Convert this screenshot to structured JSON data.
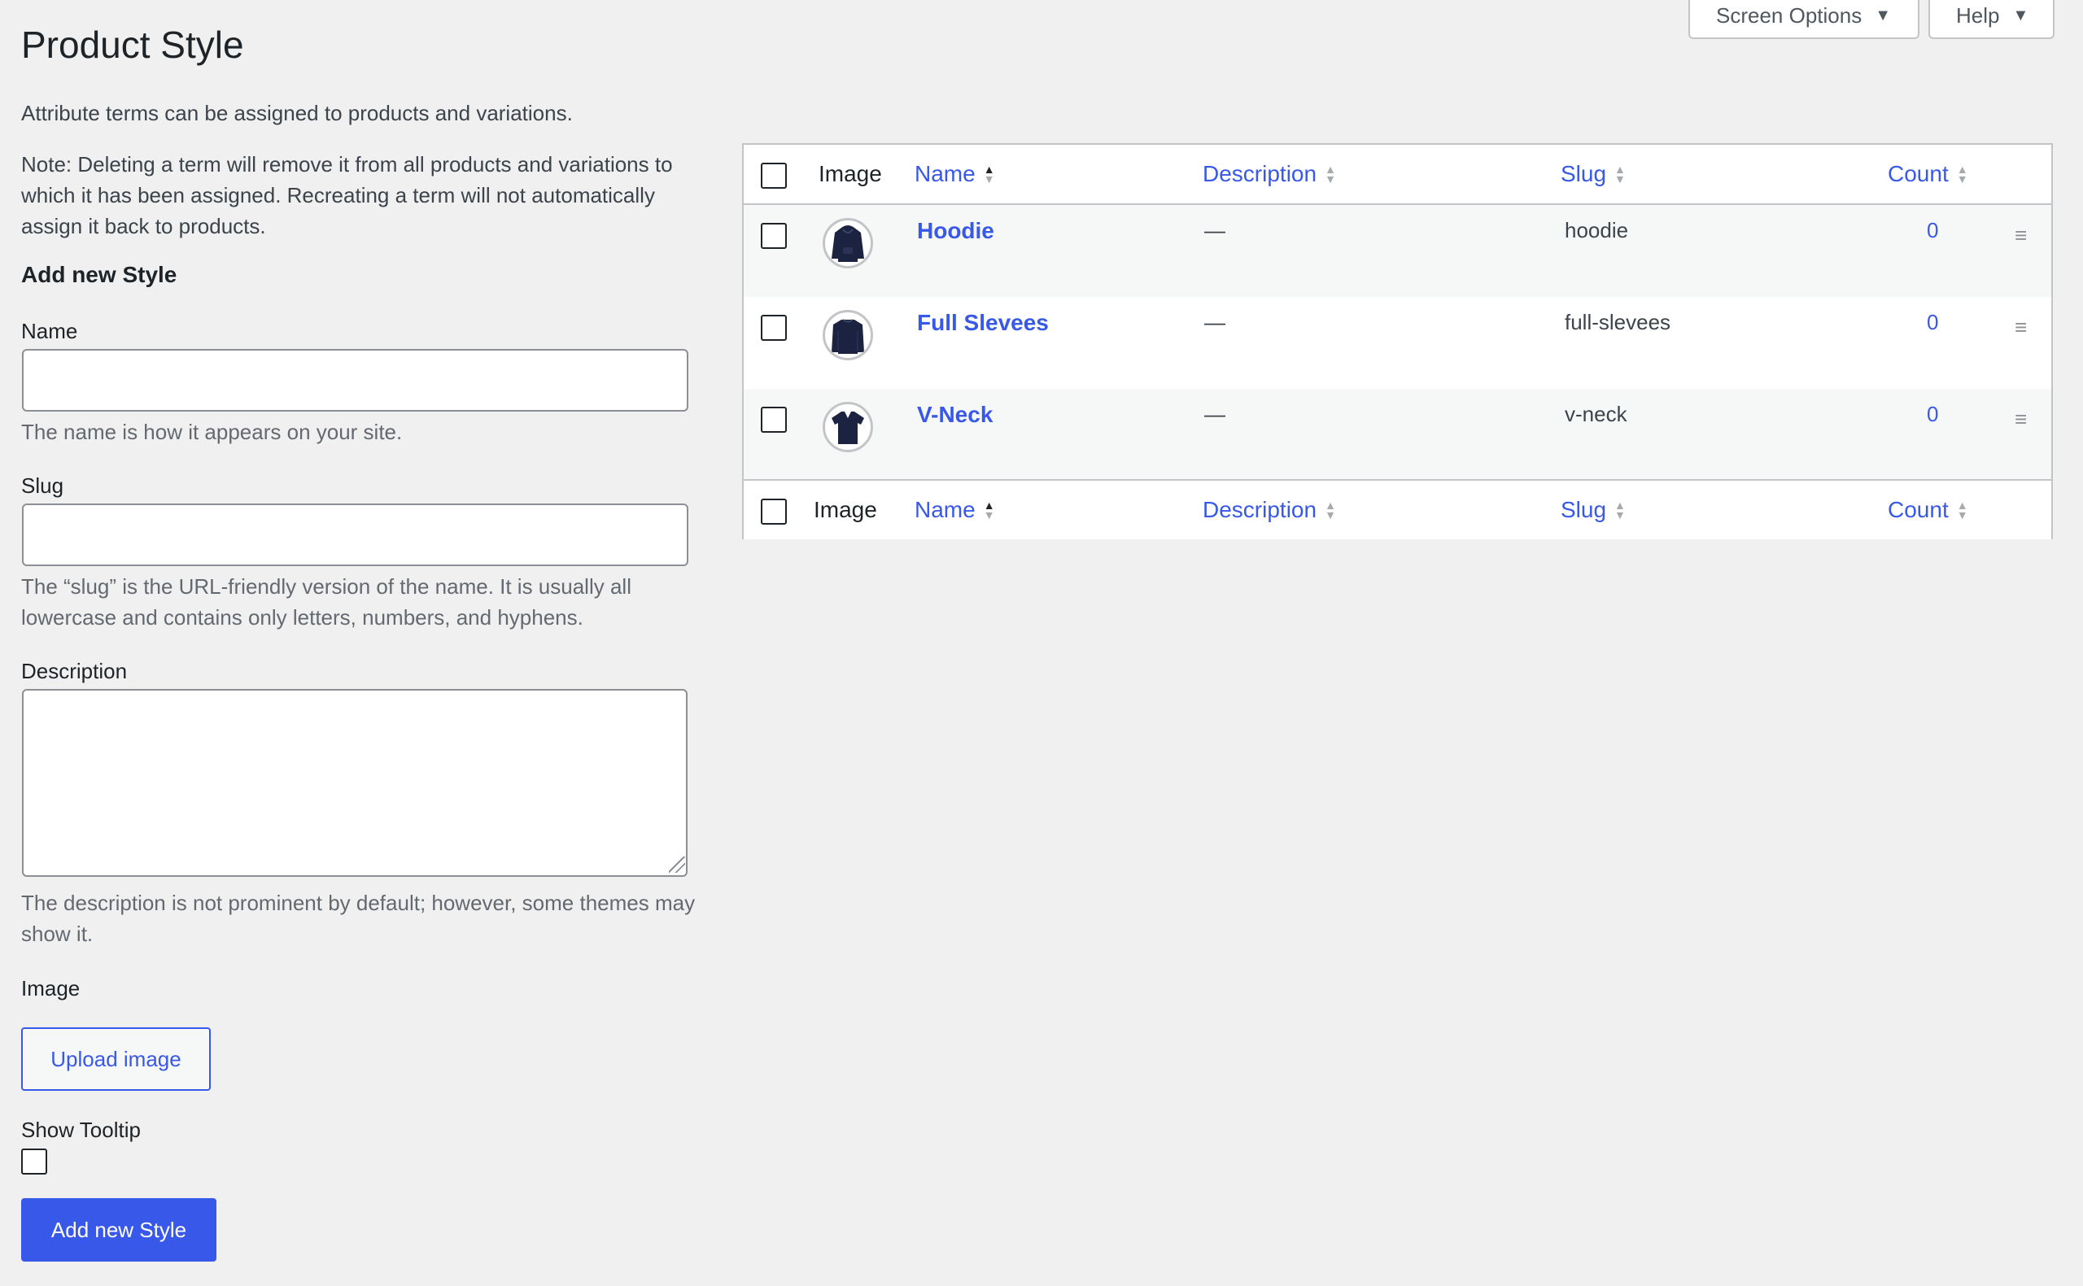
{
  "header": {
    "title": "Product Style",
    "screen_options": "Screen Options",
    "help": "Help"
  },
  "intro": {
    "line1": "Attribute terms can be assigned to products and variations.",
    "note": "Note: Deleting a term will remove it from all products and variations to which it has been assigned. Recreating a term will not automatically assign it back to products."
  },
  "form": {
    "heading": "Add new Style",
    "name_label": "Name",
    "name_value": "",
    "name_help": "The name is how it appears on your site.",
    "slug_label": "Slug",
    "slug_value": "",
    "slug_help": "The “slug” is the URL-friendly version of the name. It is usually all lowercase and contains only letters, numbers, and hyphens.",
    "description_label": "Description",
    "description_value": "",
    "description_help": "The description is not prominent by default; however, some themes may show it.",
    "image_label": "Image",
    "upload_button": "Upload image",
    "tooltip_label": "Show Tooltip",
    "tooltip_checked": false,
    "submit_button": "Add new Style"
  },
  "table": {
    "columns": {
      "image": "Image",
      "name": "Name",
      "description": "Description",
      "slug": "Slug",
      "count": "Count"
    },
    "rows": [
      {
        "name": "Hoodie",
        "description": "—",
        "slug": "hoodie",
        "count": "0",
        "image_icon": "hoodie-icon"
      },
      {
        "name": "Full Slevees",
        "description": "—",
        "slug": "full-slevees",
        "count": "0",
        "image_icon": "sweatshirt-icon"
      },
      {
        "name": "V-Neck",
        "description": "—",
        "slug": "v-neck",
        "count": "0",
        "image_icon": "tshirt-icon"
      }
    ]
  },
  "colors": {
    "accent": "#3858e9",
    "background": "#f0f0f1",
    "garment": "#1c2340"
  }
}
